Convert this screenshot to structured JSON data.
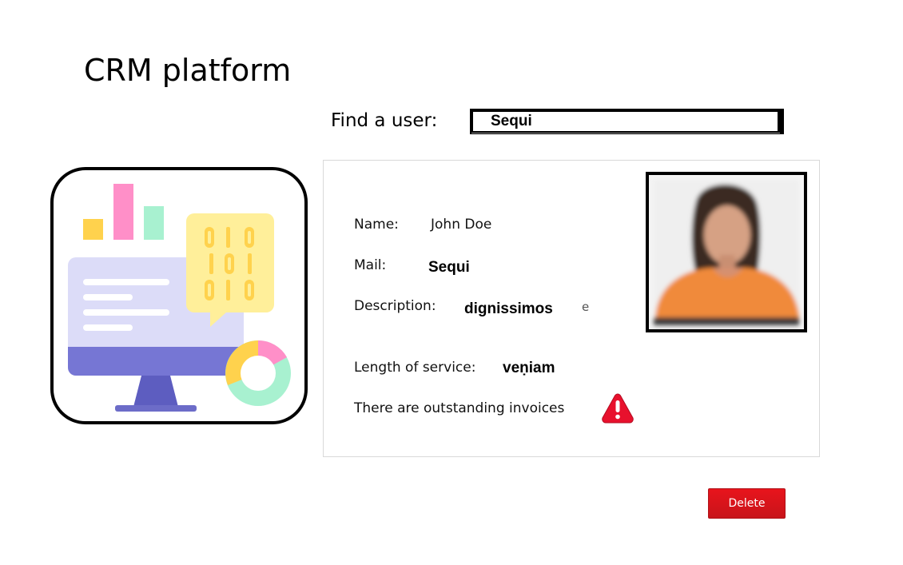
{
  "app": {
    "title": "CRM platform"
  },
  "search": {
    "label": "Find a user:",
    "value": "Sequi"
  },
  "profile": {
    "name_label": "Name:",
    "name_value": "John Doe",
    "mail_label": "Mail:",
    "mail_value": "Sequi",
    "description_label": "Description:",
    "description_value": "dignissimos",
    "description_trailing": "e",
    "service_label": "Length of service:",
    "service_value": "veṇiam",
    "invoice_warning": "There are outstanding invoices"
  },
  "icons": {
    "illustration": "crm-dashboard-illustration",
    "photo": "user-photo",
    "warning": "warning-triangle-icon"
  },
  "actions": {
    "delete_label": "Delete"
  },
  "colors": {
    "delete": "#d6141b",
    "warning": "#e8112d"
  }
}
